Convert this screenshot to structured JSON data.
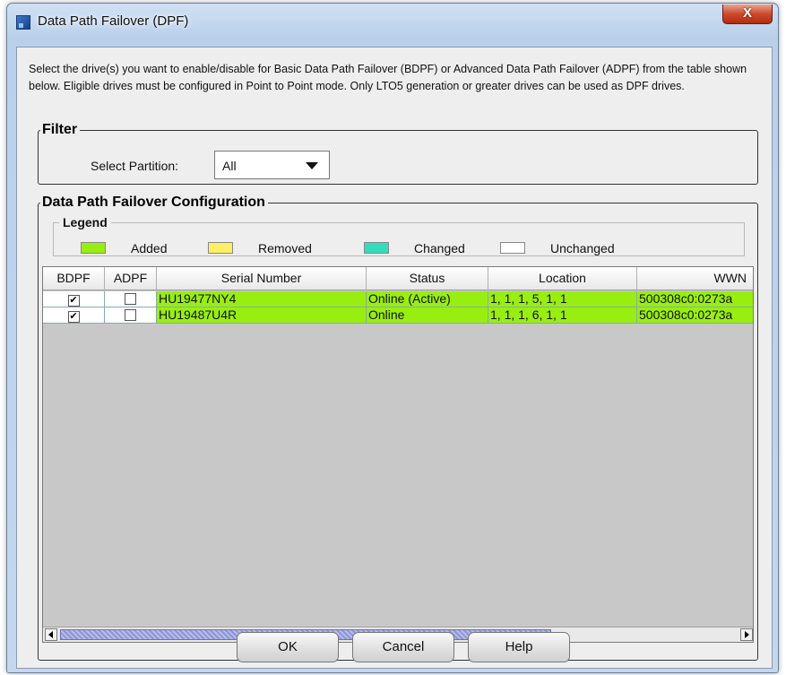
{
  "window": {
    "title": "Data Path Failover (DPF)",
    "close_label": "X"
  },
  "instructions": "Select the drive(s) you want to enable/disable for Basic Data Path Failover (BDPF) or Advanced Data Path Failover (ADPF) from the table shown below. Eligible drives must be configured in Point to Point mode. Only LTO5 generation or greater drives can be used as DPF drives.",
  "filter": {
    "title": "Filter",
    "partition_label": "Select Partition:",
    "partition_value": "All"
  },
  "config": {
    "title": "Data Path Failover Configuration",
    "legend": {
      "title": "Legend",
      "items": [
        {
          "label": "Added",
          "color": "#99ee11"
        },
        {
          "label": "Removed",
          "color": "#ffee66"
        },
        {
          "label": "Changed",
          "color": "#33ddbb"
        },
        {
          "label": "Unchanged",
          "color": "#ffffff"
        }
      ]
    },
    "table": {
      "columns": [
        "BDPF",
        "ADPF",
        "Serial Number",
        "Status",
        "Location",
        "WWN"
      ],
      "rows": [
        {
          "bdpf": true,
          "adpf": false,
          "serial": "HU19477NY4",
          "status": "Online (Active)",
          "location": "1, 1, 1, 5, 1, 1",
          "wwn": "500308c0:0273a"
        },
        {
          "bdpf": true,
          "adpf": false,
          "serial": "HU19487U4R",
          "status": "Online",
          "location": "1, 1, 1, 6, 1, 1",
          "wwn": "500308c0:0273a"
        }
      ]
    }
  },
  "buttons": {
    "ok": "OK",
    "cancel": "Cancel",
    "help": "Help"
  },
  "check_mark": "✔"
}
